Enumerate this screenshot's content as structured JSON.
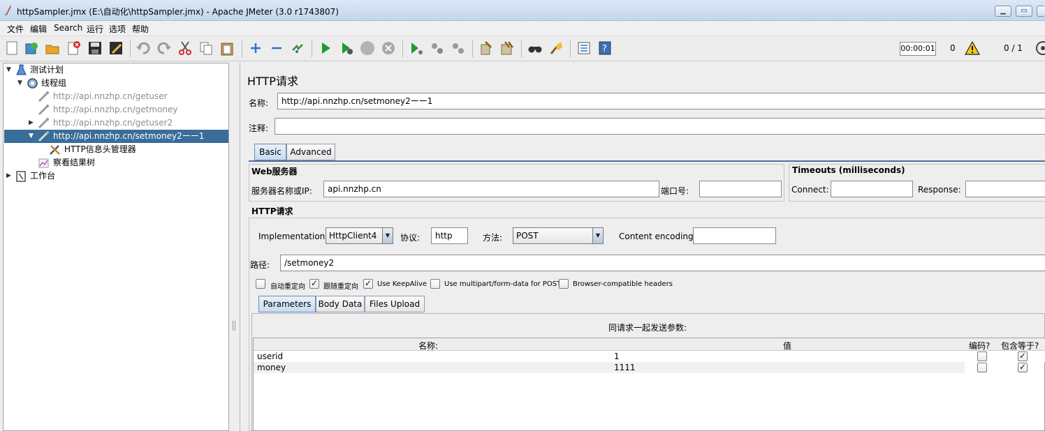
{
  "window": {
    "title": "httpSampler.jmx (E:\\自动化\\httpSampler.jmx) - Apache JMeter (3.0 r1743807)"
  },
  "menu": [
    "文件",
    "编辑",
    "Search",
    "运行",
    "选项",
    "帮助"
  ],
  "toolbar": {
    "elapsed": "00:00:01",
    "error_count": "0",
    "threads": "0 / 1"
  },
  "tree": [
    {
      "label": "测试计划",
      "icon": "flask-icon",
      "expanded": true
    },
    {
      "label": "线程组",
      "icon": "gear-icon",
      "expanded": true
    },
    {
      "label": "http://api.nnzhp.cn/getuser",
      "icon": "pipette-icon",
      "disabled": true
    },
    {
      "label": "http://api.nnzhp.cn/getmoney",
      "icon": "pipette-icon",
      "disabled": true
    },
    {
      "label": "http://api.nnzhp.cn/getuser2",
      "icon": "pipette-icon",
      "disabled": true,
      "collapsed": true
    },
    {
      "label": "http://api.nnzhp.cn/setmoney2ーー1",
      "icon": "pipette-icon",
      "selected": true,
      "expanded": true
    },
    {
      "label": "HTTP信息头管理器",
      "icon": "tools-icon"
    },
    {
      "label": "察看结果树",
      "icon": "chart-icon"
    },
    {
      "label": "工作台",
      "icon": "clipboard-icon",
      "collapsed": true
    }
  ],
  "panel": {
    "title": "HTTP请求",
    "name_label": "名称:",
    "name_value": "http://api.nnzhp.cn/setmoney2ーー1",
    "comment_label": "注释:",
    "comment_value": "",
    "tabs": [
      "Basic",
      "Advanced"
    ],
    "web_server": {
      "title": "Web服务器",
      "server_label": "服务器名称或IP:",
      "server_value": "api.nnzhp.cn",
      "port_label": "端口号:",
      "port_value": ""
    },
    "timeouts": {
      "title": "Timeouts (milliseconds)",
      "connect_label": "Connect:",
      "connect_value": "",
      "response_label": "Response:",
      "response_value": ""
    },
    "http_request": {
      "title": "HTTP请求",
      "impl_label": "Implementation:",
      "impl_value": "HttpClient4",
      "protocol_label": "协议:",
      "protocol_value": "http",
      "method_label": "方法:",
      "method_value": "POST",
      "encoding_label": "Content encoding:",
      "encoding_value": "",
      "path_label": "路径:",
      "path_value": "/setmoney2"
    },
    "options": [
      {
        "label": "自动重定向",
        "checked": false
      },
      {
        "label": "跟随重定向",
        "checked": true
      },
      {
        "label": "Use KeepAlive",
        "checked": true
      },
      {
        "label": "Use multipart/form-data for POST",
        "checked": false
      },
      {
        "label": "Browser-compatible headers",
        "checked": false
      }
    ],
    "sub_tabs": [
      "Parameters",
      "Body Data",
      "Files Upload"
    ],
    "params_caption": "同请求一起发送参数:",
    "columns": [
      "名称:",
      "值",
      "编码?",
      "包含等于?"
    ],
    "rows": [
      {
        "name": "userid",
        "value": "1",
        "encode": false,
        "include_equals": true
      },
      {
        "name": "money",
        "value": "1111",
        "encode": false,
        "include_equals": true
      }
    ]
  }
}
